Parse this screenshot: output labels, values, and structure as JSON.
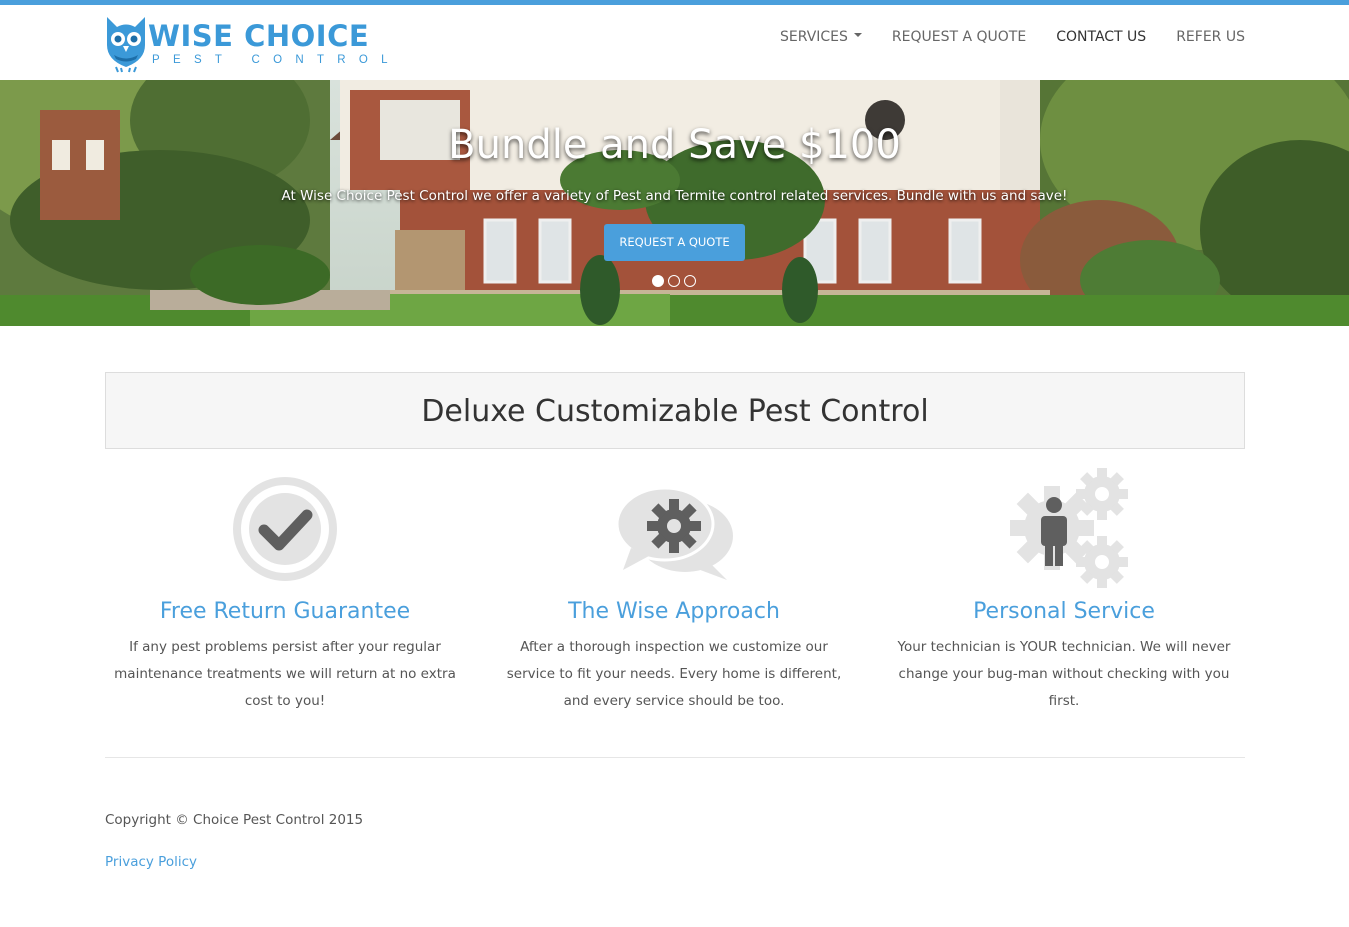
{
  "brand": {
    "name": "WISE CHOICE",
    "tagline": "PEST CONTROL",
    "color": "#3b99d8"
  },
  "nav": {
    "items": [
      {
        "label": "SERVICES",
        "dropdown": true
      },
      {
        "label": "REQUEST A QUOTE"
      },
      {
        "label": "CONTACT US",
        "active": true
      },
      {
        "label": "REFER US"
      }
    ]
  },
  "hero": {
    "title": "Bundle and Save $100",
    "subtitle": "At Wise Choice Pest Control we offer a variety of Pest and Termite control related services. Bundle with us and save!",
    "button_label": "REQUEST A QUOTE",
    "slide_count": 3,
    "active_slide": 1
  },
  "main": {
    "heading": "Deluxe Customizable Pest Control",
    "features": [
      {
        "icon": "check-circle-icon",
        "title": "Free Return Guarantee",
        "text": "If any pest problems persist after your regular maintenance treatments we will return at no extra cost to you!"
      },
      {
        "icon": "chat-gear-icon",
        "title": "The Wise Approach",
        "text": "After a thorough inspection we customize our service to fit your needs. Every home is different, and every service should be too."
      },
      {
        "icon": "person-gears-icon",
        "title": "Personal Service",
        "text": "Your technician is YOUR technician. We will never change your bug-man without checking with you first."
      }
    ]
  },
  "footer": {
    "copyright": "Copyright © Choice Pest Control 2015",
    "privacy_link": "Privacy Policy"
  },
  "colors": {
    "accent": "#4a9fdc",
    "icon_gray": "#5f5f5f",
    "icon_light": "#e3e3e3"
  }
}
